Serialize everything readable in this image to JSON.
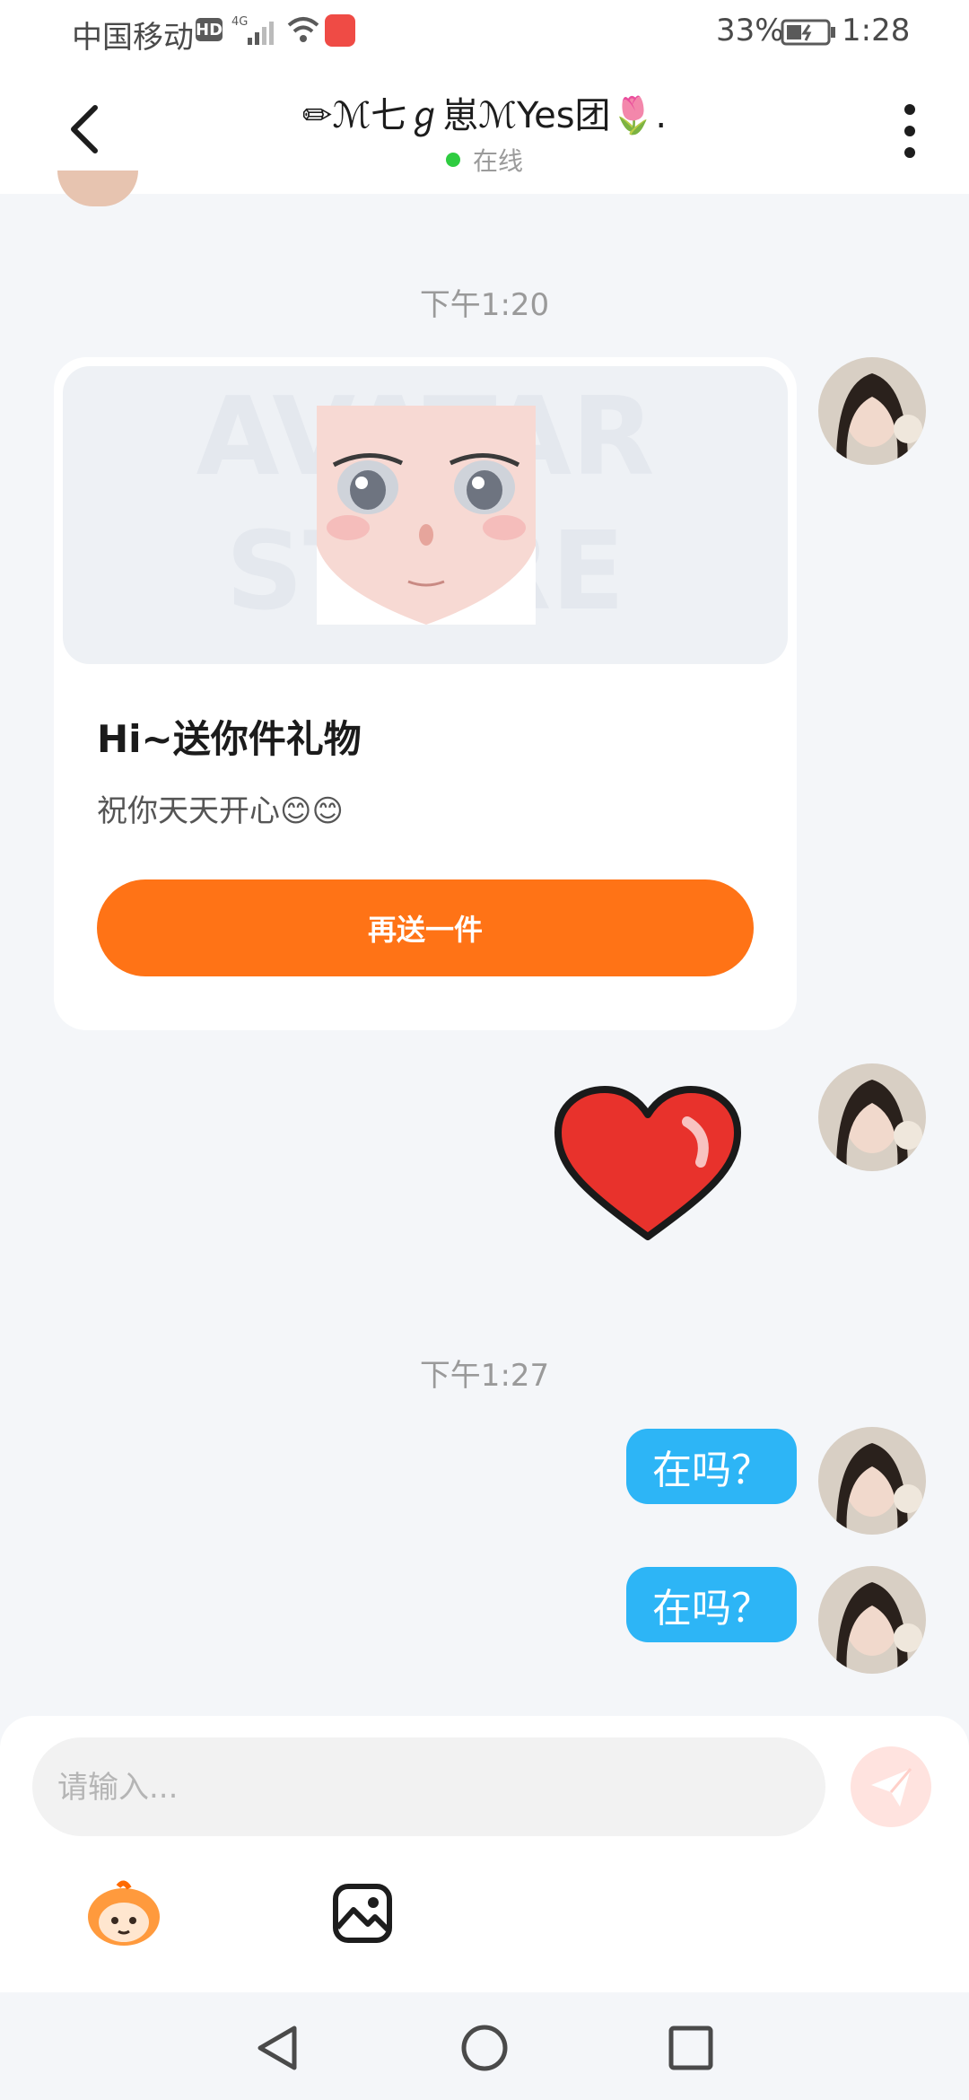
{
  "status_bar": {
    "carrier": "中国移动",
    "hd_badge": "HD",
    "network": "4G",
    "battery": "33%",
    "time": "1:28"
  },
  "header": {
    "title": "✏ℳ七ℊ崽ℳYes团🌷.",
    "status": "在线"
  },
  "messages": {
    "time_1": "下午1:20",
    "gift_card": {
      "title": "Hi~送你件礼物",
      "subtitle": "祝你天天开心😊😊",
      "button": "再送一件",
      "watermark_top": "AVATAR",
      "watermark_bottom": "STORE"
    },
    "time_2": "下午1:27",
    "bubble_1": "在吗？",
    "bubble_2": "在吗？"
  },
  "composer": {
    "placeholder": "请输入..."
  },
  "colors": {
    "accent_orange": "#ff7316",
    "bubble_blue": "#2db5f6",
    "online_green": "#2ecc40"
  }
}
